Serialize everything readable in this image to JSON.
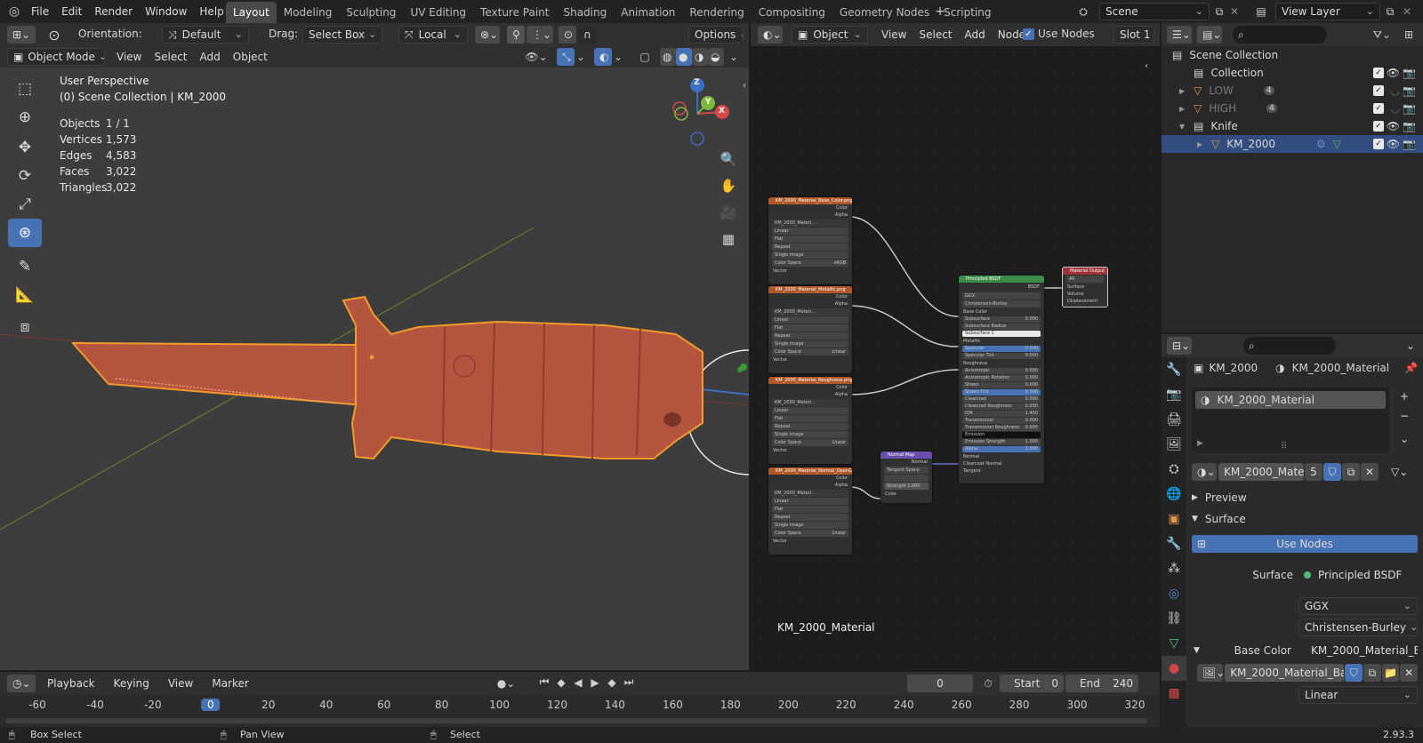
{
  "topbar": {
    "menus": [
      "File",
      "Edit",
      "Render",
      "Window",
      "Help"
    ],
    "workspaces": [
      "Layout",
      "Modeling",
      "Sculpting",
      "UV Editing",
      "Texture Paint",
      "Shading",
      "Animation",
      "Rendering",
      "Compositing",
      "Geometry Nodes",
      "Scripting"
    ],
    "active_workspace": "Layout",
    "scene": "Scene",
    "view_layer": "View Layer"
  },
  "viewport": {
    "orientation_label": "Orientation:",
    "orientation_value": "Default",
    "drag_label": "Drag:",
    "drag_value": "Select Box",
    "pivot_value": "Local",
    "options_label": "Options",
    "mode": "Object Mode",
    "menus": [
      "View",
      "Select",
      "Add",
      "Object"
    ],
    "perspective": "User Perspective",
    "collection_path": "(0) Scene Collection | KM_2000",
    "stats": [
      {
        "label": "Objects",
        "value": "1 / 1"
      },
      {
        "label": "Vertices",
        "value": "1,573"
      },
      {
        "label": "Edges",
        "value": "4,583"
      },
      {
        "label": "Faces",
        "value": "3,022"
      },
      {
        "label": "Triangles",
        "value": "3,022"
      }
    ],
    "gizmo": {
      "x": "X",
      "y": "Y",
      "z": "Z"
    },
    "object_color": "#b3553f",
    "outline_color": "#f39a2c"
  },
  "node_editor": {
    "type_value": "Object",
    "menus": [
      "View",
      "Select",
      "Add",
      "Node"
    ],
    "use_nodes_label": "Use Nodes",
    "slot": "Slot 1",
    "material_name": "KM_2000_Material",
    "texture_nodes": [
      {
        "title": "KM_2000_Material_Base_Color.png",
        "color_space": "sRGB"
      },
      {
        "title": "KM_2000_Material_Metallic.png",
        "color_space": "Linear"
      },
      {
        "title": "KM_2000_Material_Roughness.png",
        "color_space": "Linear"
      },
      {
        "title": "KM_2000_Material_Normal_OpenGL.png",
        "color_space": "Linear"
      }
    ],
    "tex_outputs": [
      "Color",
      "Alpha"
    ],
    "tex_file": "KM_2000_Materi...",
    "tex_rows": [
      "Linear",
      "Flat",
      "Repeat",
      "Single Image"
    ],
    "tex_color_space_label": "Color Space",
    "tex_vector": "Vector",
    "bsdf": {
      "title": "Principled BSDF",
      "output": "BSDF",
      "dist": "GGX",
      "sss": "Christensen-Burley",
      "inputs": [
        {
          "name": "Base Color",
          "value": ""
        },
        {
          "name": "Subsurface",
          "value": "0.000"
        },
        {
          "name": "Subsurface Radius",
          "value": ""
        },
        {
          "name": "Subsurface C",
          "value": ""
        },
        {
          "name": "Metallic",
          "value": ""
        },
        {
          "name": "Specular",
          "value": "0.500"
        },
        {
          "name": "Specular Tint",
          "value": "0.000"
        },
        {
          "name": "Roughness",
          "value": ""
        },
        {
          "name": "Anisotropic",
          "value": "0.000"
        },
        {
          "name": "Anisotropic Rotation",
          "value": "0.000"
        },
        {
          "name": "Sheen",
          "value": "0.000"
        },
        {
          "name": "Sheen Tint",
          "value": "0.500"
        },
        {
          "name": "Clearcoat",
          "value": "0.000"
        },
        {
          "name": "Clearcoat Roughness",
          "value": "0.030"
        },
        {
          "name": "IOR",
          "value": "1.450"
        },
        {
          "name": "Transmission",
          "value": "0.000"
        },
        {
          "name": "Transmission Roughness",
          "value": "0.000"
        },
        {
          "name": "Emission",
          "value": ""
        },
        {
          "name": "Emission Strength",
          "value": "1.000"
        },
        {
          "name": "Alpha",
          "value": "1.000"
        },
        {
          "name": "Normal",
          "value": ""
        },
        {
          "name": "Clearcoat Normal",
          "value": ""
        },
        {
          "name": "Tangent",
          "value": ""
        }
      ]
    },
    "normal_map": {
      "title": "Normal Map",
      "output": "Normal",
      "space": "Tangent Space",
      "strength_label": "Strength",
      "strength": "1.000",
      "color": "Color"
    },
    "output_node": {
      "title": "Material Output",
      "target": "All",
      "inputs": [
        "Surface",
        "Volume",
        "Displacement"
      ]
    }
  },
  "outliner": {
    "scene_collection": "Scene Collection",
    "items": [
      {
        "name": "Collection",
        "dim": false,
        "badge": ""
      },
      {
        "name": "LOW",
        "dim": true,
        "badge": "4"
      },
      {
        "name": "HIGH",
        "dim": true,
        "badge": "4"
      },
      {
        "name": "Knife",
        "dim": false,
        "badge": ""
      },
      {
        "name": "KM_2000",
        "dim": false,
        "badge": ""
      }
    ]
  },
  "properties": {
    "object_name": "KM_2000",
    "material_name": "KM_2000_Material",
    "slot_item": "KM_2000_Material",
    "material_field": "KM_2000_Mate...",
    "users": "5",
    "preview_label": "Preview",
    "surface_label": "Surface",
    "use_nodes_button": "Use Nodes",
    "surface_field_label": "Surface",
    "surface_shader": "Principled BSDF",
    "distribution": "GGX",
    "subsurface_method": "Christensen-Burley",
    "base_color_label": "Base Color",
    "base_color_value": "KM_2000_Material_B...",
    "image_name": "KM_2000_Material_Bas...",
    "interpolation": "Linear"
  },
  "timeline": {
    "menus": [
      "Playback",
      "Keying",
      "View",
      "Marker"
    ],
    "current_frame": "0",
    "start_label": "Start",
    "start": "0",
    "end_label": "End",
    "end": "240",
    "ticks": [
      "-60",
      "-40",
      "-20",
      "0",
      "20",
      "40",
      "60",
      "80",
      "100",
      "120",
      "140",
      "160",
      "180",
      "200",
      "220",
      "240",
      "260",
      "280",
      "300",
      "320"
    ]
  },
  "statusbar": {
    "box_select": "Box Select",
    "pan_view": "Pan View",
    "select": "Select",
    "version": "2.93.3"
  }
}
